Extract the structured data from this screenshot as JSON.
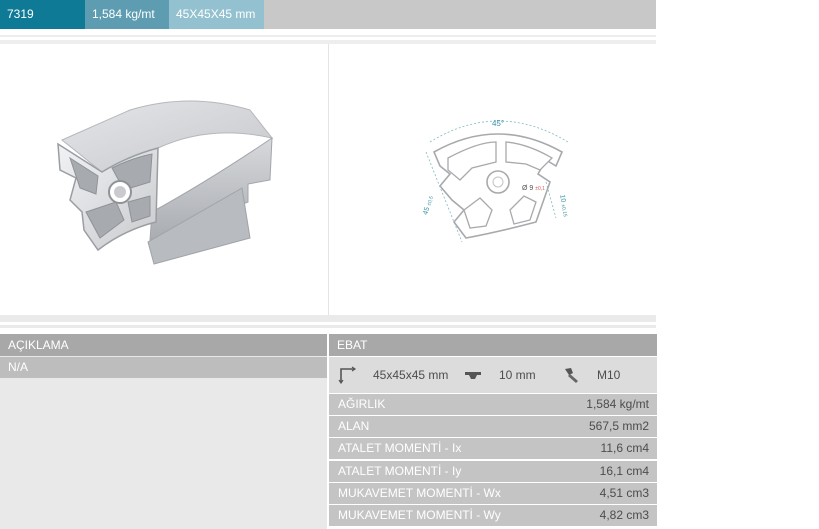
{
  "header": {
    "code": "7319",
    "weight": "1,584 kg/mt",
    "size": "45X45X45 mm"
  },
  "drawing": {
    "angle": "45°",
    "side": "45",
    "side_tol": "±0,5",
    "hole": "Ø 9",
    "hole_tol": "±0,1",
    "slot": "10",
    "slot_tol": "±0,15"
  },
  "description": {
    "title": "AÇIKLAMA",
    "value": "N/A"
  },
  "dimensions": {
    "title": "EBAT",
    "size": "45x45x45 mm",
    "slot": "10 mm",
    "screw": "M10"
  },
  "properties": [
    {
      "label": "AĞIRLIK",
      "value": "1,584 kg/mt"
    },
    {
      "label": "ALAN",
      "value": "567,5 mm2"
    },
    {
      "label": "ATALET MOMENTİ - Ix",
      "value": "11,6 cm4"
    },
    {
      "label": "ATALET MOMENTİ - Iy",
      "value": "16,1 cm4"
    },
    {
      "label": "MUKAVEMET MOMENTİ - Wx",
      "value": "4,51 cm3"
    },
    {
      "label": "MUKAVEMET MOMENTİ - Wy",
      "value": "4,82 cm3"
    }
  ],
  "icons": [
    "corner-dimension-icon",
    "slot-profile-icon",
    "screw-icon"
  ]
}
